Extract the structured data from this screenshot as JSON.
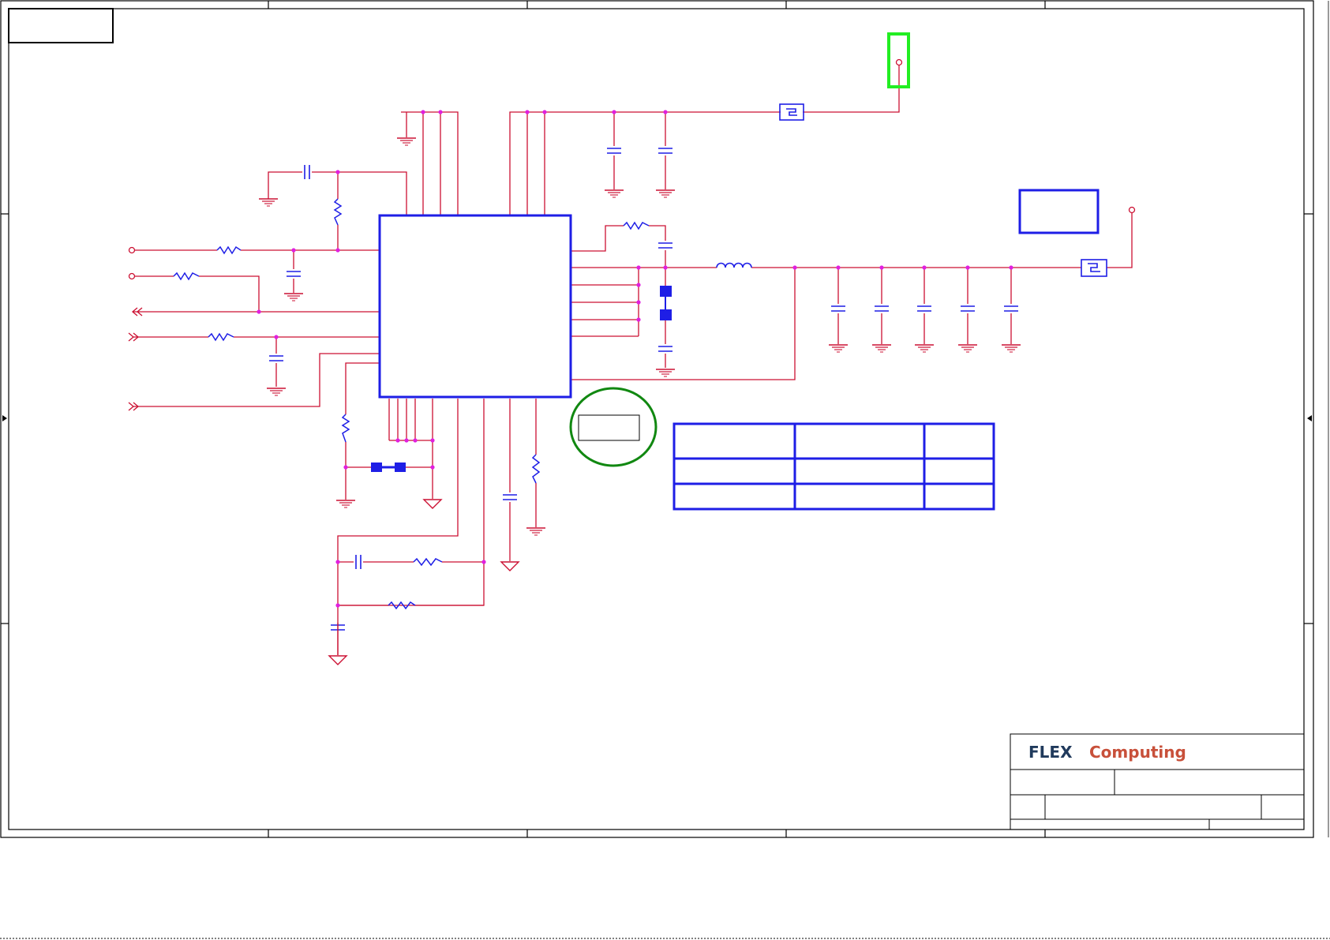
{
  "title_block": {
    "logo": {
      "brand": "FLEX",
      "brand_suffix": "Computing",
      "brand_color": "#203a5c",
      "accent_color": "#c8503a"
    }
  },
  "colors": {
    "wire": "#cc1133",
    "component": "#1e1ee6",
    "junction": "#e020e0",
    "frame": "#000000",
    "highlight_green": "#22ee22",
    "note_circle": "#118811"
  }
}
